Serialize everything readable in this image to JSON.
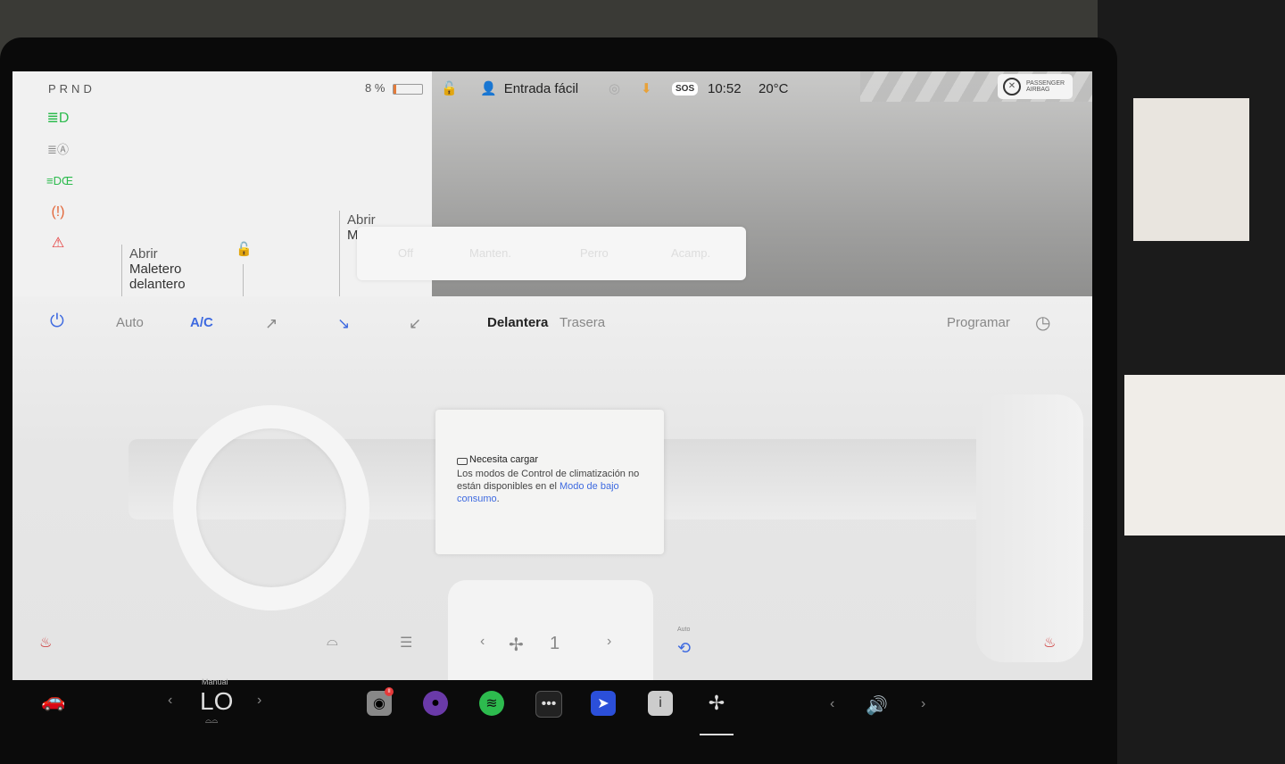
{
  "status": {
    "prnd": "PRND",
    "battery_pct": "8 %",
    "battery_level": 0.08,
    "driver_profile": "Entrada fácil",
    "sos": "SOS",
    "time": "10:52",
    "temperature": "20°C",
    "airbag_line1": "PASSENGER",
    "airbag_line2": "AIRBAG"
  },
  "vehicle": {
    "front_trunk_line1": "Abrir",
    "front_trunk_line2": "Maletero",
    "front_trunk_line3": "delantero",
    "rear_trunk_line1": "Abrir",
    "rear_trunk_line2": "M"
  },
  "modes": {
    "off": "Off",
    "keep": "Manten.",
    "dog": "Perro",
    "camp": "Acamp."
  },
  "climate": {
    "auto": "Auto",
    "ac": "A/C",
    "front": "Delantera",
    "rear": "Trasera",
    "schedule": "Programar",
    "fan_speed": "1",
    "recirc_label": "Auto"
  },
  "popup": {
    "title": "Necesita cargar",
    "body": "Los modos de Control de climatización no están disponibles en el ",
    "link": "Modo de bajo consumo",
    "end": "."
  },
  "taskbar": {
    "temp_mode": "Manual",
    "temp_value": "LO",
    "camera_badge": "II"
  },
  "colors": {
    "accent": "#3e6ae0",
    "battery": "#e37b3a",
    "green": "#2dbb4e",
    "warning": "#e2673a",
    "red": "#e53a3a"
  }
}
